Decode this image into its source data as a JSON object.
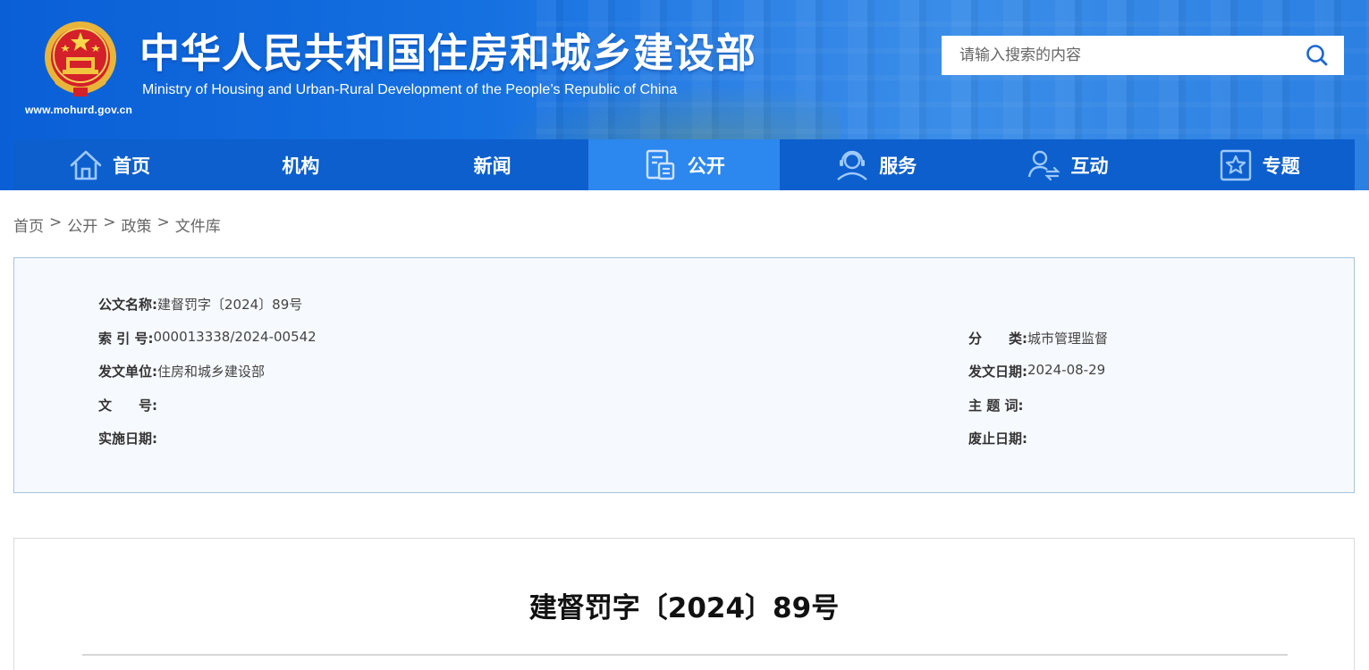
{
  "header": {
    "site_title": "中华人民共和国住房和城乡建设部",
    "site_subtitle": "Ministry of Housing and Urban-Rural Development of the People’s Republic of China",
    "site_url": "www.mohurd.gov.cn",
    "search_placeholder": "请输入搜索的内容",
    "colors": {
      "banner": "#1570e0",
      "nav": "#0c5fcc",
      "nav_active": "#2c87ee",
      "search_icon": "#1a66d6"
    }
  },
  "nav": {
    "items": [
      {
        "label": "首页",
        "icon": "home-icon"
      },
      {
        "label": "机构",
        "icon": ""
      },
      {
        "label": "新闻",
        "icon": ""
      },
      {
        "label": "公开",
        "icon": "document-open-icon",
        "active": true
      },
      {
        "label": "服务",
        "icon": "customer-service-icon"
      },
      {
        "label": "互动",
        "icon": "user-exchange-icon"
      },
      {
        "label": "专题",
        "icon": "star-box-icon"
      }
    ]
  },
  "breadcrumb": {
    "items": [
      "首页",
      "公开",
      "政策",
      "文件库"
    ],
    "separator": ">"
  },
  "meta": {
    "doc_name_label": "公文名称:",
    "doc_name": "建督罚字〔2024〕89号",
    "index_label": "索 引 号:",
    "index": "000013338/2024-00542",
    "category_label": "分　　类:",
    "category": "城市管理监督",
    "issuer_label": "发文单位:",
    "issuer": "住房和城乡建设部",
    "issue_date_label": "发文日期:",
    "issue_date": "2024-08-29",
    "doc_no_label": "文　　号:",
    "doc_no": "",
    "subject_label": "主 题 词:",
    "subject": "",
    "effective_label": "实施日期:",
    "effective": "",
    "expiry_label": "废止日期:",
    "expiry": ""
  },
  "article": {
    "title": "建督罚字〔2024〕89号"
  }
}
